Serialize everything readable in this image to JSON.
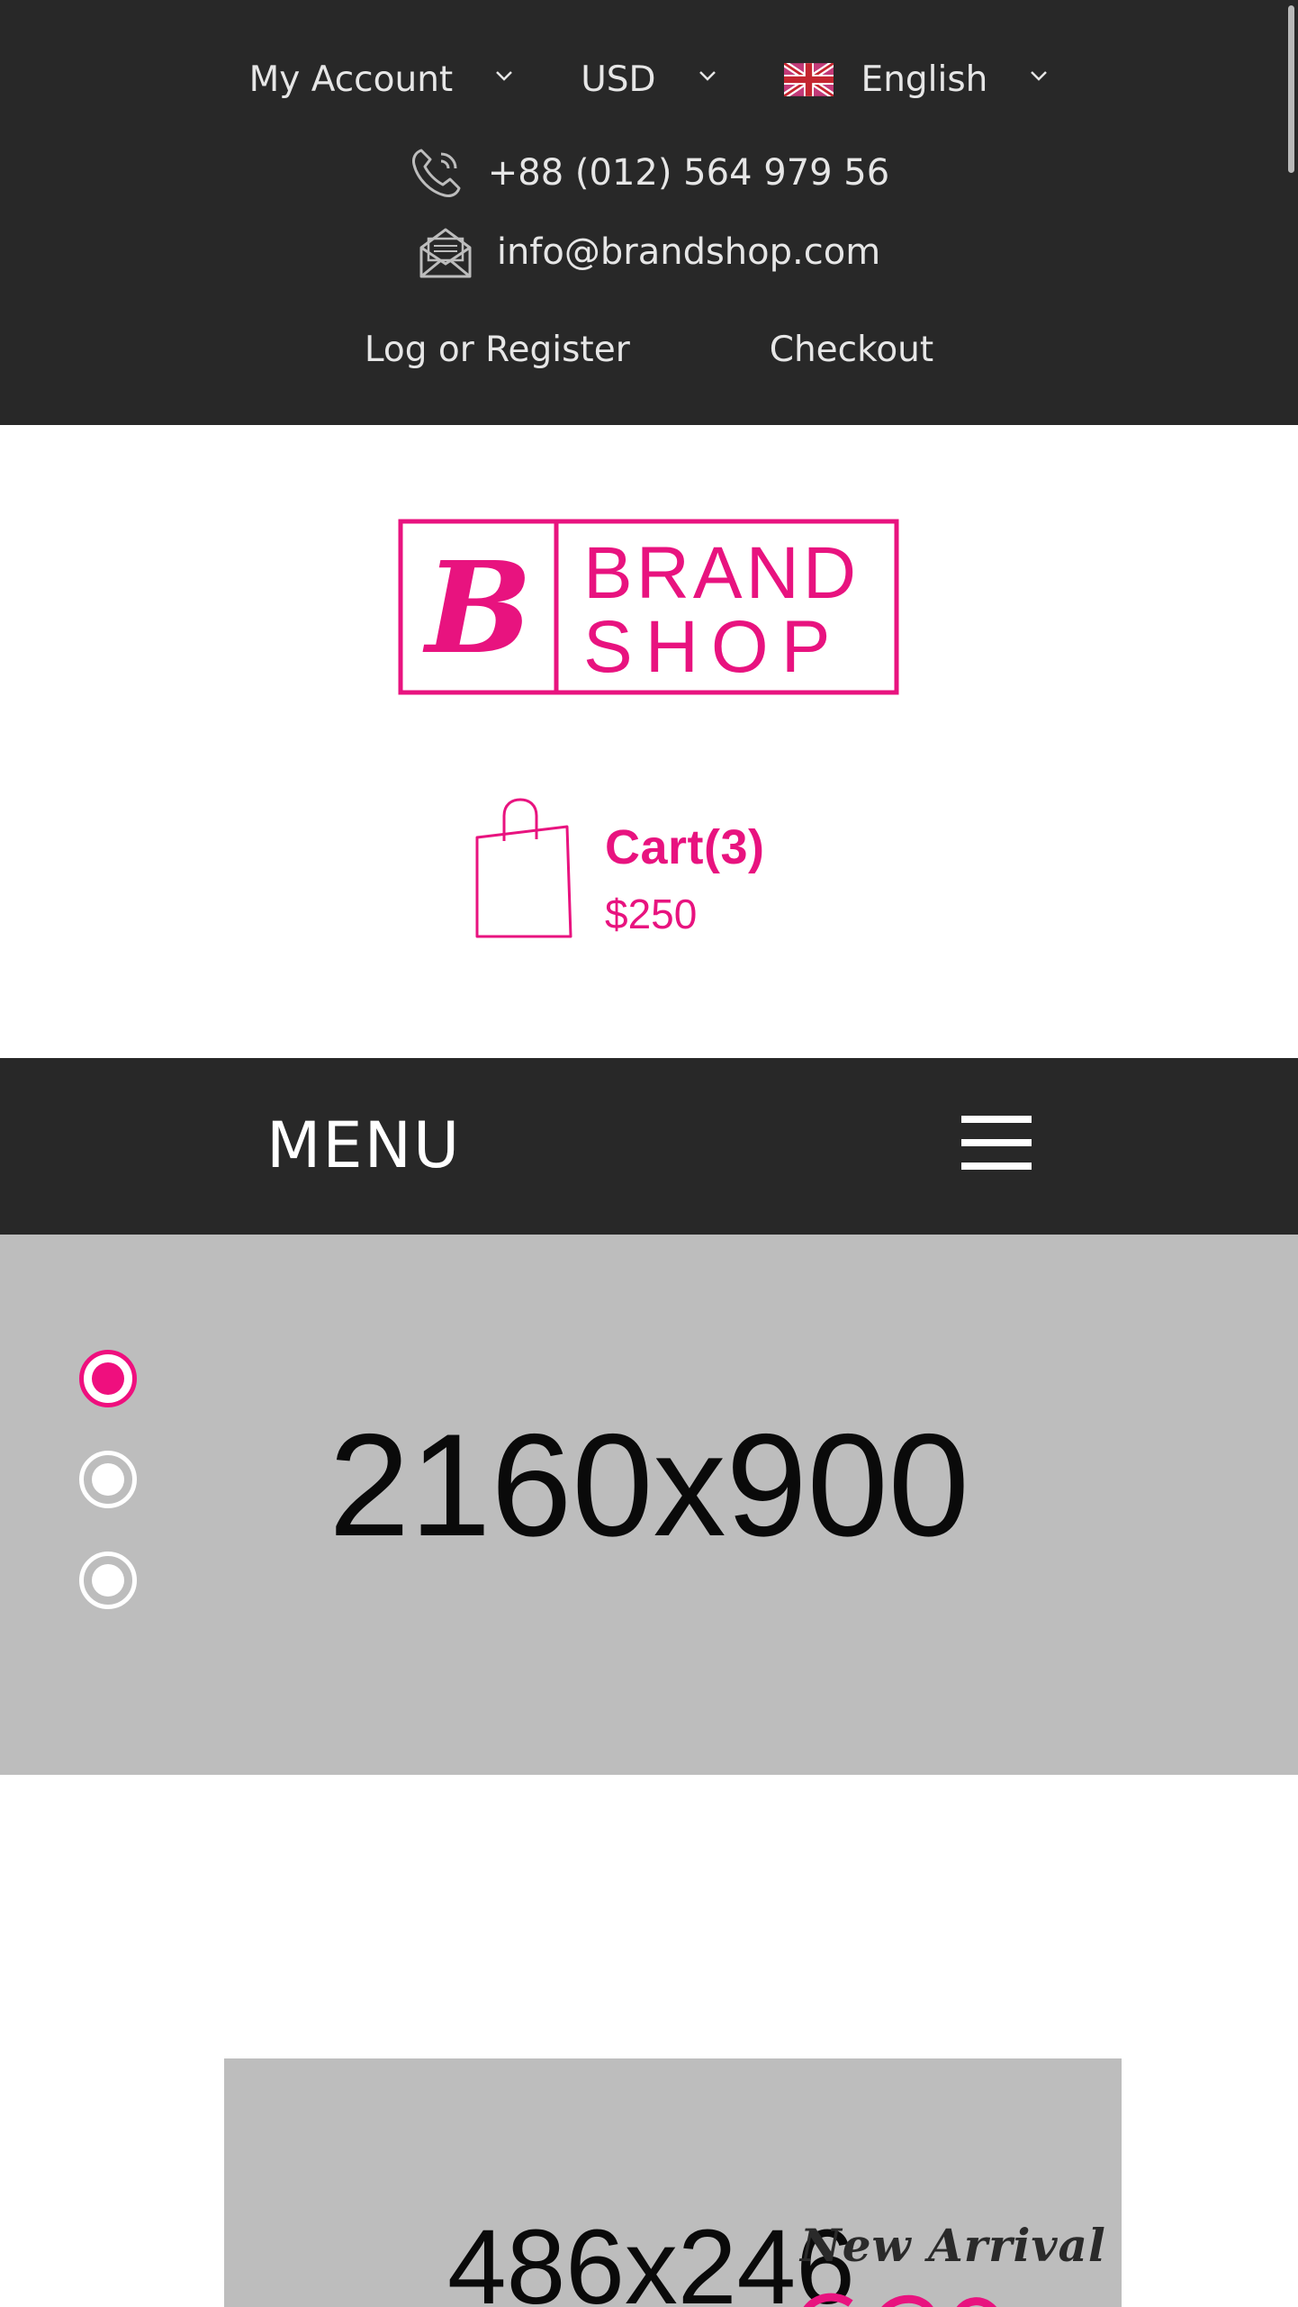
{
  "header": {
    "account_label": "My Account",
    "currency_label": "USD",
    "language_label": "English",
    "phone": "+88 (012) 564 979 56",
    "email": "info@brandshop.com",
    "login_label": "Log or Register",
    "checkout_label": "Checkout"
  },
  "brand": {
    "logo_text_line1": "BRAND",
    "logo_text_line2": "SHOP",
    "logo_monogram": "B",
    "accent_color": "#e8137f"
  },
  "cart": {
    "title": "Cart(3)",
    "total": "$250"
  },
  "menu": {
    "label": "MENU"
  },
  "slider": {
    "placeholder": "2160x900",
    "dots": [
      "active",
      "idle",
      "idle"
    ]
  },
  "banner": {
    "placeholder": "486x246",
    "caption": "New Arrival"
  },
  "icons": {
    "phone": "phone-icon",
    "email": "envelope-icon",
    "cart": "shopping-bag-icon",
    "menu": "hamburger-icon",
    "chevron": "chevron-down-icon",
    "flag": "uk-flag-icon"
  }
}
